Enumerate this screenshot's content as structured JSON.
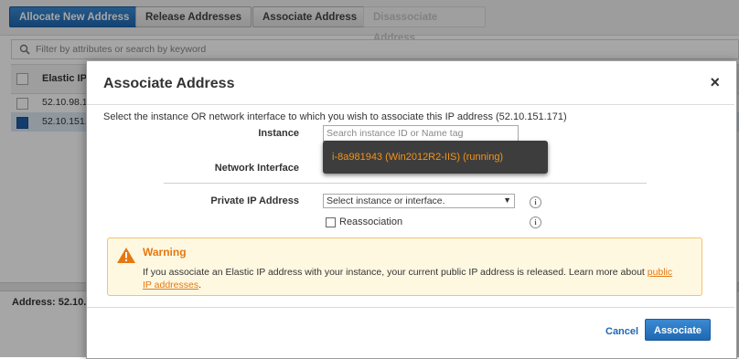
{
  "toolbar": {
    "allocate": "Allocate New Address",
    "release": "Release Addresses",
    "associate": "Associate Address",
    "disassociate": "Disassociate Address"
  },
  "filter": {
    "placeholder": "Filter by attributes or search by keyword"
  },
  "table": {
    "column": "Elastic IP",
    "rows": [
      {
        "ip": "52.10.98.1",
        "selected": false
      },
      {
        "ip": "52.10.151.",
        "selected": true
      }
    ]
  },
  "details": {
    "address_label": "Address: 52.10."
  },
  "modal": {
    "title": "Associate Address",
    "close": "×",
    "instructions": "Select the instance OR network interface to which you wish to associate this IP address (52.10.151.171)",
    "instance_label": "Instance",
    "instance_placeholder": "Search instance ID or Name tag",
    "instance_option": "i-8a981943 (Win2012R2-IIS) (running)",
    "network_interface_label": "Network Interface",
    "private_ip_label": "Private IP Address",
    "private_ip_value": "Select instance or interface.",
    "reassociation_label": "Reassociation",
    "info_glyph": "i",
    "warning": {
      "title": "Warning",
      "text": "If you associate an Elastic IP address with your instance, your current public IP address is released. Learn more about ",
      "link_part1": "public",
      "link_part2": "IP addresses",
      "trailing": "."
    },
    "cancel": "Cancel",
    "associate": "Associate"
  },
  "colors": {
    "primary": "#1f68b2",
    "warning_accent": "#e47911",
    "dropdown_text": "#f39419"
  }
}
